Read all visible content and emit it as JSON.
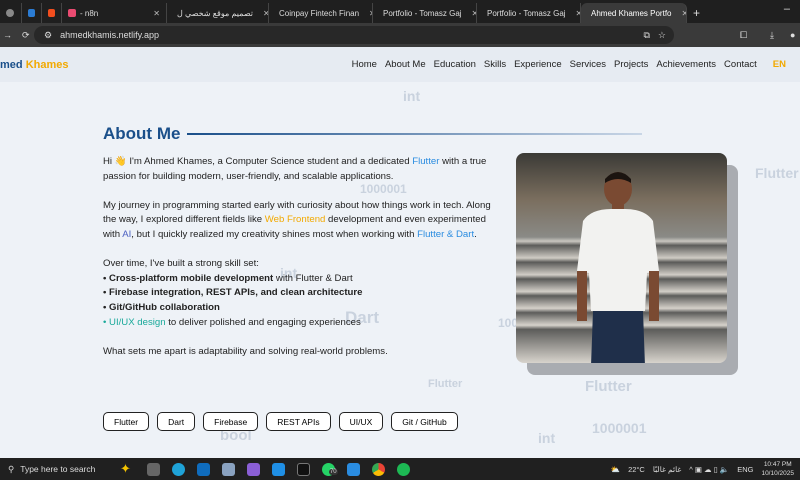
{
  "browser": {
    "tabs": [
      {
        "title": "",
        "color": "#2b7cd3"
      },
      {
        "title": "",
        "color": "#f24e1e"
      },
      {
        "title": "- n8n",
        "color": "#ea4b71"
      },
      {
        "title": "تصميم موقع شخصي ل",
        "color": "#f2a900"
      },
      {
        "title": "Coinpay Fintech Finan",
        "color": "#f24e1e"
      },
      {
        "title": "Portfolio - Tomasz Gaj",
        "color": "#f24e1e"
      },
      {
        "title": "Portfolio - Tomasz Gaj",
        "color": "#f24e1e"
      },
      {
        "title": "Ahmed Khames Portfo",
        "color": "#aaaaaa"
      }
    ],
    "new_tab": "+",
    "url": "ahmedkhamis.netlify.app"
  },
  "site": {
    "logo_first": "med",
    "logo_second": "Khames",
    "nav": [
      "Home",
      "About Me",
      "Education",
      "Skills",
      "Experience",
      "Services",
      "Projects",
      "Achievements",
      "Contact"
    ],
    "lang": "EN"
  },
  "about": {
    "title": "About Me",
    "p1": {
      "a": "Hi 👋 I'm Ahmed Khames, a Computer Science student and a dedicated ",
      "flutter": "Flutter",
      "b": " with a true passion for building modern, user-friendly, and scalable applications."
    },
    "p2": {
      "a": " My journey in programming started early with curiosity about how things work in tech. Along the way, I explored different fields like ",
      "wf": "Web Frontend",
      "b": " development and even experimented with ",
      "ai": "AI",
      "c": ", but I quickly realized my creativity shines most when working with ",
      "fd": "Flutter & Dart",
      "d": "."
    },
    "p3": {
      "intro": "Over time, I've built a strong skill set:",
      "s1b": "• Cross-platform mobile development",
      "s1": " with Flutter & Dart",
      "s2": "• Firebase integration, REST APIs, and clean architecture",
      "s3": "• Git/GitHub collaboration",
      "s4b": "• UI/UX design",
      "s4": " to deliver polished and engaging experiences"
    },
    "p4": "What sets me apart is adaptability and solving real-world problems.",
    "tags": [
      "Flutter",
      "Dart",
      "Firebase",
      "REST APIs",
      "UI/UX",
      "Git / GitHub"
    ]
  },
  "background_words": [
    "int",
    "1000001",
    "Flutter",
    "int",
    "Dart",
    "1000001",
    "Flutter",
    "int",
    "bool",
    "1000001",
    "Dart"
  ],
  "taskbar": {
    "search": "Type here to search",
    "whatsapp_badge": "70",
    "weather": "22°C",
    "weather_text": "غائم غالبًا",
    "lang": "ENG",
    "time": "10:47 PM",
    "date": "10/10/2025"
  },
  "colors": {
    "primary": "#1a4f8a",
    "accent": "#f2a900",
    "flutter": "#2a8ce0"
  }
}
